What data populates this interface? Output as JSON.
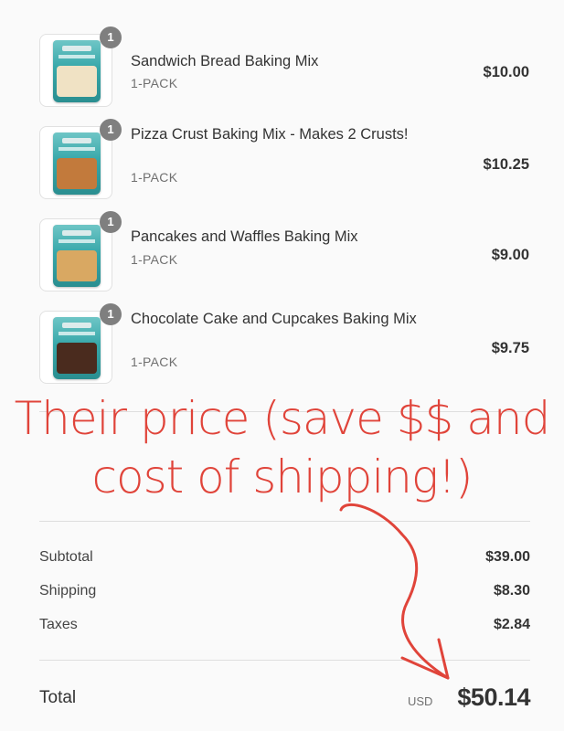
{
  "items": [
    {
      "qty": "1",
      "name": "Sandwich Bread Baking Mix",
      "variant": "1-PACK",
      "price": "$10.00",
      "food_color": "#f0e2c4"
    },
    {
      "qty": "1",
      "name": "Pizza Crust Baking Mix - Makes 2 Crusts!",
      "variant": "1-PACK",
      "price": "$10.25",
      "food_color": "#c27a3c"
    },
    {
      "qty": "1",
      "name": "Pancakes and Waffles Baking Mix",
      "variant": "1-PACK",
      "price": "$9.00",
      "food_color": "#d9a862"
    },
    {
      "qty": "1",
      "name": "Chocolate Cake and Cupcakes Baking Mix",
      "variant": "1-PACK",
      "price": "$9.75",
      "food_color": "#4a2b1e"
    }
  ],
  "annotation": {
    "line1": "Their price (save $$ and",
    "line2": "cost of shipping!)",
    "color": "#e0443a"
  },
  "summary": {
    "subtotal_label": "Subtotal",
    "subtotal_value": "$39.00",
    "shipping_label": "Shipping",
    "shipping_value": "$8.30",
    "taxes_label": "Taxes",
    "taxes_value": "$2.84",
    "total_label": "Total",
    "currency": "USD",
    "total_value": "$50.14"
  }
}
